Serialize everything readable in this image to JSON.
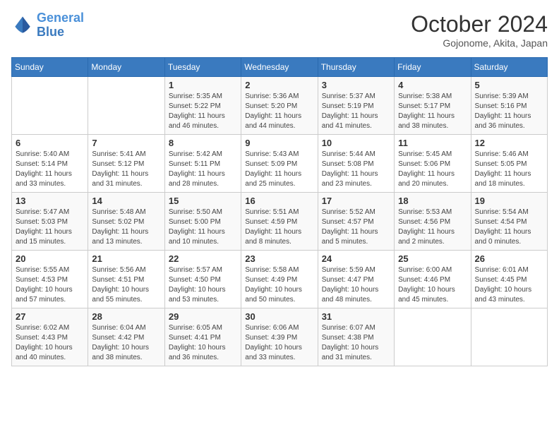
{
  "header": {
    "logo_line1": "General",
    "logo_line2": "Blue",
    "month": "October 2024",
    "location": "Gojonome, Akita, Japan"
  },
  "weekdays": [
    "Sunday",
    "Monday",
    "Tuesday",
    "Wednesday",
    "Thursday",
    "Friday",
    "Saturday"
  ],
  "weeks": [
    [
      {
        "day": "",
        "sunrise": "",
        "sunset": "",
        "daylight": ""
      },
      {
        "day": "",
        "sunrise": "",
        "sunset": "",
        "daylight": ""
      },
      {
        "day": "1",
        "sunrise": "Sunrise: 5:35 AM",
        "sunset": "Sunset: 5:22 PM",
        "daylight": "Daylight: 11 hours and 46 minutes."
      },
      {
        "day": "2",
        "sunrise": "Sunrise: 5:36 AM",
        "sunset": "Sunset: 5:20 PM",
        "daylight": "Daylight: 11 hours and 44 minutes."
      },
      {
        "day": "3",
        "sunrise": "Sunrise: 5:37 AM",
        "sunset": "Sunset: 5:19 PM",
        "daylight": "Daylight: 11 hours and 41 minutes."
      },
      {
        "day": "4",
        "sunrise": "Sunrise: 5:38 AM",
        "sunset": "Sunset: 5:17 PM",
        "daylight": "Daylight: 11 hours and 38 minutes."
      },
      {
        "day": "5",
        "sunrise": "Sunrise: 5:39 AM",
        "sunset": "Sunset: 5:16 PM",
        "daylight": "Daylight: 11 hours and 36 minutes."
      }
    ],
    [
      {
        "day": "6",
        "sunrise": "Sunrise: 5:40 AM",
        "sunset": "Sunset: 5:14 PM",
        "daylight": "Daylight: 11 hours and 33 minutes."
      },
      {
        "day": "7",
        "sunrise": "Sunrise: 5:41 AM",
        "sunset": "Sunset: 5:12 PM",
        "daylight": "Daylight: 11 hours and 31 minutes."
      },
      {
        "day": "8",
        "sunrise": "Sunrise: 5:42 AM",
        "sunset": "Sunset: 5:11 PM",
        "daylight": "Daylight: 11 hours and 28 minutes."
      },
      {
        "day": "9",
        "sunrise": "Sunrise: 5:43 AM",
        "sunset": "Sunset: 5:09 PM",
        "daylight": "Daylight: 11 hours and 25 minutes."
      },
      {
        "day": "10",
        "sunrise": "Sunrise: 5:44 AM",
        "sunset": "Sunset: 5:08 PM",
        "daylight": "Daylight: 11 hours and 23 minutes."
      },
      {
        "day": "11",
        "sunrise": "Sunrise: 5:45 AM",
        "sunset": "Sunset: 5:06 PM",
        "daylight": "Daylight: 11 hours and 20 minutes."
      },
      {
        "day": "12",
        "sunrise": "Sunrise: 5:46 AM",
        "sunset": "Sunset: 5:05 PM",
        "daylight": "Daylight: 11 hours and 18 minutes."
      }
    ],
    [
      {
        "day": "13",
        "sunrise": "Sunrise: 5:47 AM",
        "sunset": "Sunset: 5:03 PM",
        "daylight": "Daylight: 11 hours and 15 minutes."
      },
      {
        "day": "14",
        "sunrise": "Sunrise: 5:48 AM",
        "sunset": "Sunset: 5:02 PM",
        "daylight": "Daylight: 11 hours and 13 minutes."
      },
      {
        "day": "15",
        "sunrise": "Sunrise: 5:50 AM",
        "sunset": "Sunset: 5:00 PM",
        "daylight": "Daylight: 11 hours and 10 minutes."
      },
      {
        "day": "16",
        "sunrise": "Sunrise: 5:51 AM",
        "sunset": "Sunset: 4:59 PM",
        "daylight": "Daylight: 11 hours and 8 minutes."
      },
      {
        "day": "17",
        "sunrise": "Sunrise: 5:52 AM",
        "sunset": "Sunset: 4:57 PM",
        "daylight": "Daylight: 11 hours and 5 minutes."
      },
      {
        "day": "18",
        "sunrise": "Sunrise: 5:53 AM",
        "sunset": "Sunset: 4:56 PM",
        "daylight": "Daylight: 11 hours and 2 minutes."
      },
      {
        "day": "19",
        "sunrise": "Sunrise: 5:54 AM",
        "sunset": "Sunset: 4:54 PM",
        "daylight": "Daylight: 11 hours and 0 minutes."
      }
    ],
    [
      {
        "day": "20",
        "sunrise": "Sunrise: 5:55 AM",
        "sunset": "Sunset: 4:53 PM",
        "daylight": "Daylight: 10 hours and 57 minutes."
      },
      {
        "day": "21",
        "sunrise": "Sunrise: 5:56 AM",
        "sunset": "Sunset: 4:51 PM",
        "daylight": "Daylight: 10 hours and 55 minutes."
      },
      {
        "day": "22",
        "sunrise": "Sunrise: 5:57 AM",
        "sunset": "Sunset: 4:50 PM",
        "daylight": "Daylight: 10 hours and 53 minutes."
      },
      {
        "day": "23",
        "sunrise": "Sunrise: 5:58 AM",
        "sunset": "Sunset: 4:49 PM",
        "daylight": "Daylight: 10 hours and 50 minutes."
      },
      {
        "day": "24",
        "sunrise": "Sunrise: 5:59 AM",
        "sunset": "Sunset: 4:47 PM",
        "daylight": "Daylight: 10 hours and 48 minutes."
      },
      {
        "day": "25",
        "sunrise": "Sunrise: 6:00 AM",
        "sunset": "Sunset: 4:46 PM",
        "daylight": "Daylight: 10 hours and 45 minutes."
      },
      {
        "day": "26",
        "sunrise": "Sunrise: 6:01 AM",
        "sunset": "Sunset: 4:45 PM",
        "daylight": "Daylight: 10 hours and 43 minutes."
      }
    ],
    [
      {
        "day": "27",
        "sunrise": "Sunrise: 6:02 AM",
        "sunset": "Sunset: 4:43 PM",
        "daylight": "Daylight: 10 hours and 40 minutes."
      },
      {
        "day": "28",
        "sunrise": "Sunrise: 6:04 AM",
        "sunset": "Sunset: 4:42 PM",
        "daylight": "Daylight: 10 hours and 38 minutes."
      },
      {
        "day": "29",
        "sunrise": "Sunrise: 6:05 AM",
        "sunset": "Sunset: 4:41 PM",
        "daylight": "Daylight: 10 hours and 36 minutes."
      },
      {
        "day": "30",
        "sunrise": "Sunrise: 6:06 AM",
        "sunset": "Sunset: 4:39 PM",
        "daylight": "Daylight: 10 hours and 33 minutes."
      },
      {
        "day": "31",
        "sunrise": "Sunrise: 6:07 AM",
        "sunset": "Sunset: 4:38 PM",
        "daylight": "Daylight: 10 hours and 31 minutes."
      },
      {
        "day": "",
        "sunrise": "",
        "sunset": "",
        "daylight": ""
      },
      {
        "day": "",
        "sunrise": "",
        "sunset": "",
        "daylight": ""
      }
    ]
  ]
}
